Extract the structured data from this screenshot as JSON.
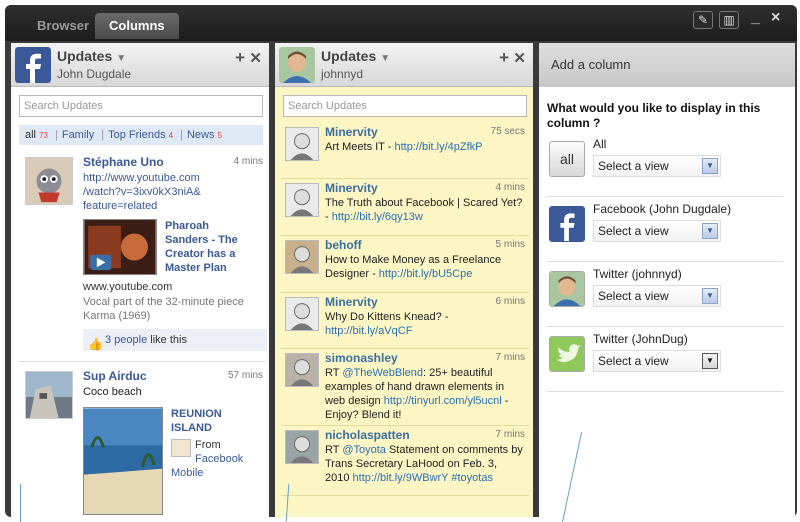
{
  "tabs": [
    {
      "label": "Browser"
    },
    {
      "label": "Columns"
    }
  ],
  "window_controls": {
    "minimize": "_",
    "close": "×"
  },
  "facebook_column": {
    "title": "Updates",
    "user": "John Dugdale",
    "search_placeholder": "Search Updates",
    "filters": [
      {
        "label": "all",
        "count": "73"
      },
      {
        "label": "Family",
        "count": ""
      },
      {
        "label": "Top Friends",
        "count": "4"
      },
      {
        "label": "News",
        "count": "5"
      }
    ],
    "posts": [
      {
        "author": "Stéphane Uno",
        "time": "4 mins",
        "url_lines": [
          "http://www.youtube.com",
          "/watch?v=3ixv0kX3niA&",
          "feature=related"
        ],
        "attachment_title": [
          "Pharoah",
          "Sanders - The",
          "Creator has a",
          "Master Plan"
        ],
        "domain": "www.youtube.com",
        "description": "Vocal part of the 32-minute piece Karma (1969)",
        "likes_link": "3 people",
        "likes_rest": " like this"
      },
      {
        "author": "Sup Airduc",
        "time": "57 mins",
        "text": "Coco beach",
        "attachment_title": [
          "REUNION",
          "ISLAND"
        ],
        "from_label": "From",
        "from_source": "Facebook",
        "from_source2": "Mobile"
      }
    ]
  },
  "twitter_column": {
    "title": "Updates",
    "user": "johnnyd",
    "search_placeholder": "Search Updates",
    "tweets": [
      {
        "author": "Minervity",
        "time": "75 secs",
        "parts": [
          {
            "t": "Art Meets IT - "
          },
          {
            "t": "http://bit.ly/4pZfkP",
            "link": true
          }
        ]
      },
      {
        "author": "Minervity",
        "time": "4 mins",
        "parts": [
          {
            "t": "The Truth about Facebook | Scared Yet? - "
          },
          {
            "t": "http://bit.ly/6qy13w",
            "link": true
          }
        ]
      },
      {
        "author": "behoff",
        "time": "5 mins",
        "parts": [
          {
            "t": "How to Make Money as a Freelance Designer - "
          },
          {
            "t": "http://bit.ly/bU5Cpe",
            "link": true
          }
        ]
      },
      {
        "author": "Minervity",
        "time": "6 mins",
        "parts": [
          {
            "t": "Why Do Kittens Knead? - "
          },
          {
            "t": "http://bit.ly/aVqCF",
            "link": true
          }
        ]
      },
      {
        "author": "simonashley",
        "time": "7 mins",
        "parts": [
          {
            "t": "RT "
          },
          {
            "t": "@TheWebBlend",
            "link": true
          },
          {
            "t": ": 25+ beautiful examples of hand drawn elements in web design "
          },
          {
            "t": "http://tinyurl.com/yl5ucnl",
            "link": true
          },
          {
            "t": " - Enjoy? Blend it!"
          }
        ]
      },
      {
        "author": "nicholaspatten",
        "time": "7 mins",
        "parts": [
          {
            "t": "RT "
          },
          {
            "t": "@Toyota",
            "link": true
          },
          {
            "t": " Statement on comments by Trans Secretary LaHood on Feb. 3, 2010 "
          },
          {
            "t": "http://bit.ly/9WBwrY",
            "link": true
          },
          {
            "t": " "
          },
          {
            "t": "#toyotas",
            "link": true
          }
        ]
      }
    ]
  },
  "add_column": {
    "header": "Add a column",
    "question": "What would you like to display in this column ?",
    "options": [
      {
        "label": "All",
        "icon": "all-icon",
        "icon_text": "all",
        "select": "Select a view"
      },
      {
        "label": "Facebook (John Dugdale)",
        "icon": "facebook-icon",
        "select": "Select a view"
      },
      {
        "label": "Twitter (johnnyd)",
        "icon": "twitter-avatar",
        "select": "Select a view"
      },
      {
        "label": "Twitter (JohnDug)",
        "icon": "twitter-bird-icon",
        "select": "Select a view"
      }
    ]
  },
  "colors": {
    "facebook_blue": "#3b5998",
    "twitter_bg": "#fbf6c4",
    "title_bar": "#1c1c1c"
  }
}
